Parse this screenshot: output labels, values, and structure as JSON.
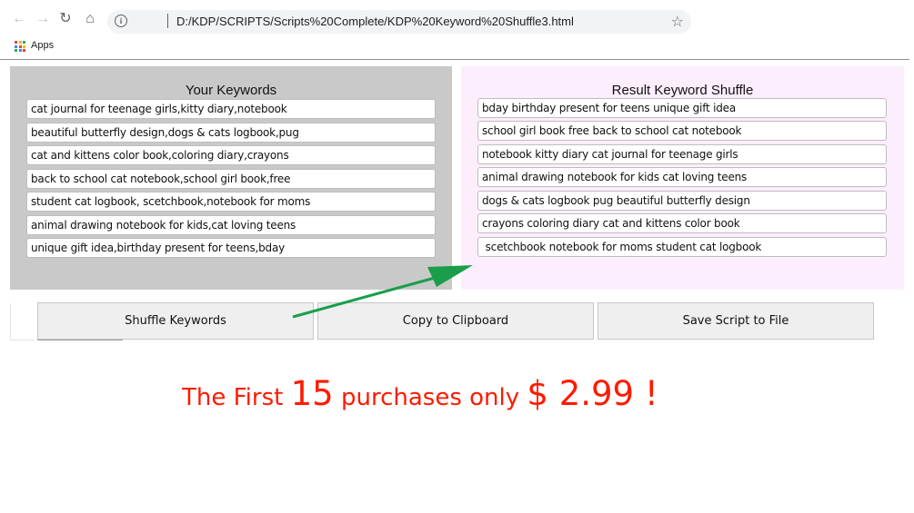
{
  "browser": {
    "url": "D:/KDP/SCRIPTS/Scripts%20Complete/KDP%20Keyword%20Shuffle3.html",
    "bookmarks_apps_label": "Apps",
    "icons": [
      "back-arrow",
      "forward-arrow",
      "reload",
      "home",
      "info",
      "star",
      "apps-grid"
    ]
  },
  "left_panel": {
    "title": "Your Keywords",
    "keywords": [
      "cat journal for teenage girls,kitty diary,notebook",
      "beautiful butterfly design,dogs & cats logbook,pug",
      "cat and kittens color book,coloring diary,crayons",
      "back to school cat notebook,school girl book,free",
      "student cat logbook, scetchbook,notebook for moms",
      "animal drawing notebook for kids,cat loving teens",
      "unique gift idea,birthday present for teens,bday"
    ]
  },
  "right_panel": {
    "title": "Result Keyword Shuffle",
    "keywords": [
      "bday birthday present for teens unique gift idea",
      "school girl book free back to school cat notebook",
      "notebook kitty diary cat journal for teenage girls",
      "animal drawing notebook for kids cat loving teens",
      "dogs & cats logbook pug beautiful butterfly design",
      "crayons coloring diary cat and kittens color book",
      " scetchbook notebook for moms student cat logbook"
    ]
  },
  "buttons": {
    "shuffle": "Shuffle Keywords",
    "copy": "Copy to Clipboard",
    "save": "Save Script to File"
  },
  "promo": {
    "part1": "The First ",
    "number": "15",
    "part2": " purchases only ",
    "price": "$ 2.99",
    "exclaim": " !"
  },
  "colors": {
    "left_panel_bg": "#c9c9c9",
    "right_panel_bg": "#fdeefe",
    "arrow": "#1a9e4a",
    "promo_text": "#ff1a00"
  }
}
